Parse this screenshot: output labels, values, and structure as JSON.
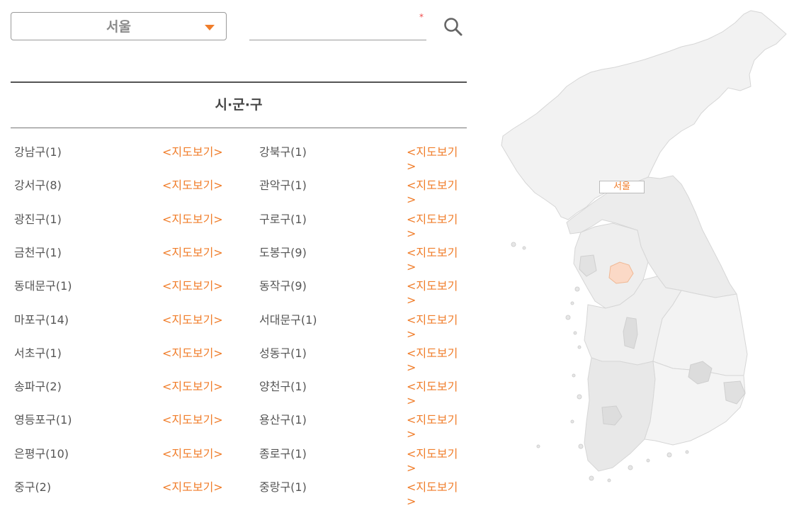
{
  "region_select": {
    "value": "서울"
  },
  "search": {
    "value": "",
    "placeholder": "",
    "required_mark": "*"
  },
  "table": {
    "header": "시·군·구",
    "link_label": "<지도보기>",
    "items": [
      {
        "name": "강남구(1)"
      },
      {
        "name": "강북구(1)"
      },
      {
        "name": "강서구(8)"
      },
      {
        "name": "관악구(1)"
      },
      {
        "name": "광진구(1)"
      },
      {
        "name": "구로구(1)"
      },
      {
        "name": "금천구(1)"
      },
      {
        "name": "도봉구(9)"
      },
      {
        "name": "동대문구(1)"
      },
      {
        "name": "동작구(9)"
      },
      {
        "name": "마포구(14)"
      },
      {
        "name": "서대문구(1)"
      },
      {
        "name": "서초구(1)"
      },
      {
        "name": "성동구(1)"
      },
      {
        "name": "송파구(2)"
      },
      {
        "name": "양천구(1)"
      },
      {
        "name": "영등포구(1)"
      },
      {
        "name": "용산구(1)"
      },
      {
        "name": "은평구(10)"
      },
      {
        "name": "종로구(1)"
      },
      {
        "name": "중구(2)"
      },
      {
        "name": "중랑구(1)"
      }
    ]
  },
  "map": {
    "selected_label": "서울",
    "accent_color": "#f07d2a",
    "highlight_color": "#fbd9c6"
  }
}
